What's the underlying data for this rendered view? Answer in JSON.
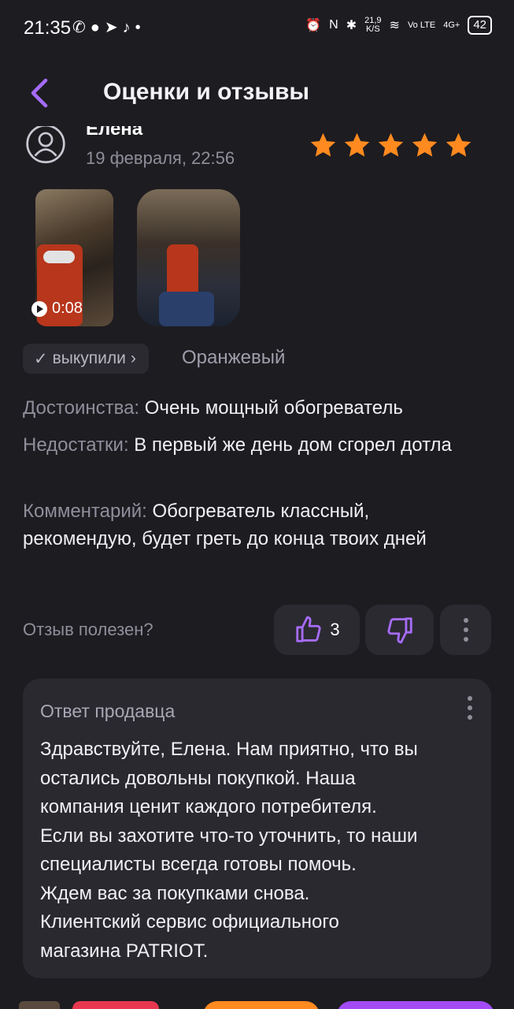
{
  "status_bar": {
    "time": "21:35",
    "left_icons": [
      "whatsapp-icon",
      "chat-icon",
      "telegram-icon",
      "tiktok-icon",
      "dot-icon"
    ],
    "net_speed_value": "21,9",
    "net_speed_unit": "K/S",
    "lte_label": "Vo LTE",
    "signal_label": "4G+",
    "battery": "42"
  },
  "header": {
    "title": "Оценки и отзывы"
  },
  "review": {
    "author": "Елена",
    "date": "19 февраля, 22:56",
    "rating": 5,
    "video_duration": "0:08",
    "bought_label": "выкупили",
    "color_variant": "Оранжевый",
    "pros_label": "Достоинства:",
    "pros": "Очень мощный обогреватель",
    "cons_label": "Недостатки:",
    "cons": "В первый же день дом сгорел дотла",
    "comment_label": "Комментарий:",
    "comment": "Обогреватель классный, рекомендую, будет греть до конца твоих дней",
    "helpful_label": "Отзыв полезен?",
    "likes": "3"
  },
  "seller_reply": {
    "title": "Ответ продавца",
    "text": "Здравствуйте, Елена. Нам приятно, что вы\nостались довольны покупкой. Наша\nкомпания ценит каждого потребителя.\nЕсли вы захотите что-то уточнить, то наши\nспециалисты всегда готовы помочь.\nЖдем вас за покупками снова.\nКлиентский сервис официального\nмагазина PATRIOT."
  },
  "colors": {
    "background": "#1d1c21",
    "accent_purple": "#a66cf7",
    "star_orange": "#ff8a1f",
    "card": "#2a2930"
  }
}
